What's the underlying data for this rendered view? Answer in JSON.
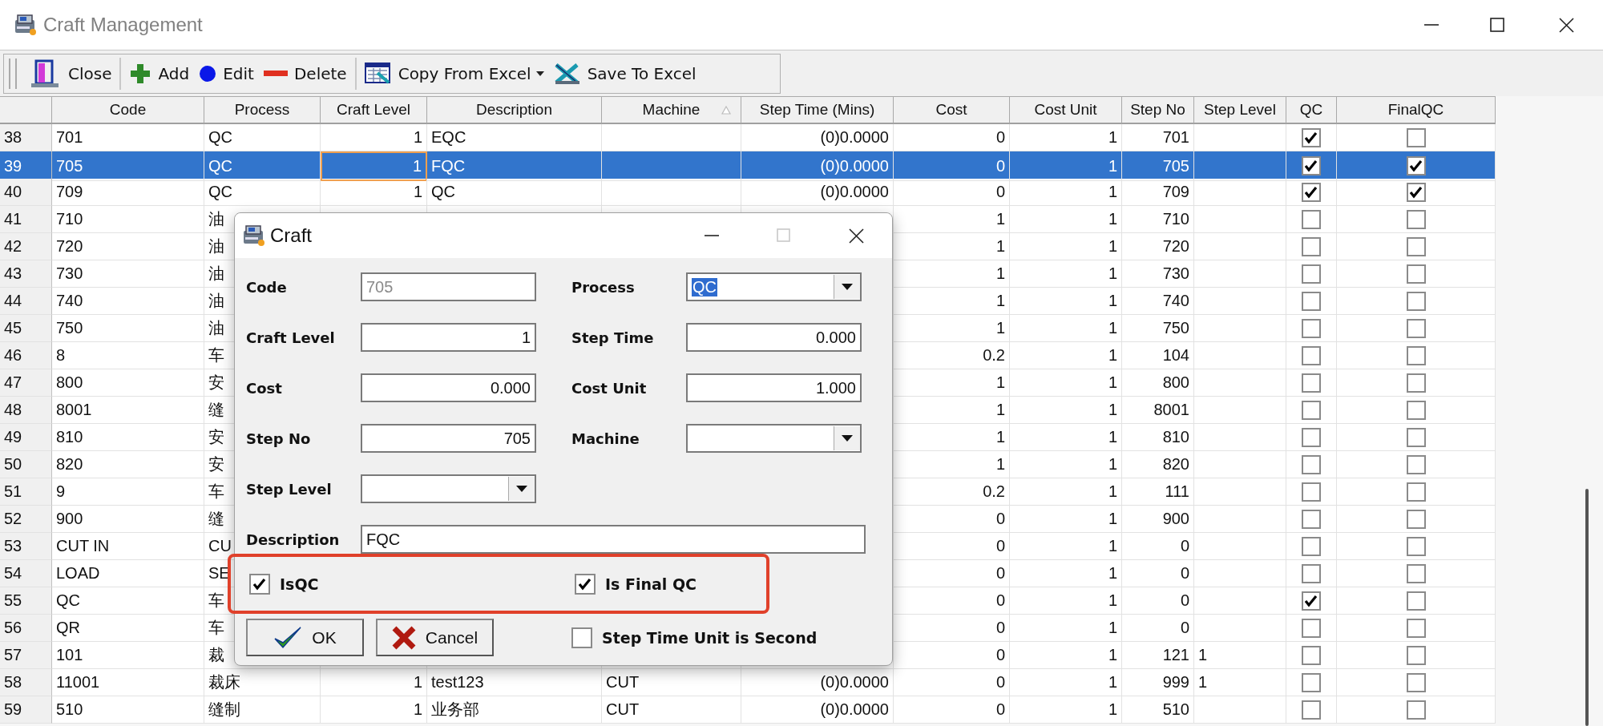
{
  "window": {
    "title": "Craft Management"
  },
  "toolbar": {
    "groups": [
      {
        "buttons": [
          {
            "label": "Close",
            "kind": "close"
          }
        ]
      },
      {
        "buttons": [
          {
            "label": "Add",
            "kind": "add"
          },
          {
            "label": "Edit",
            "kind": "edit"
          },
          {
            "label": "Delete",
            "kind": "delete"
          }
        ]
      },
      {
        "buttons": [
          {
            "label": "Copy From Excel",
            "kind": "copy",
            "dropdown": true
          },
          {
            "label": "Save To Excel",
            "kind": "save"
          }
        ]
      }
    ]
  },
  "table": {
    "columns": [
      {
        "label": "Code"
      },
      {
        "label": "Process"
      },
      {
        "label": "Craft Level"
      },
      {
        "label": "Description"
      },
      {
        "label": "Machine",
        "sorted": true
      },
      {
        "label": "Step Time (Mins)"
      },
      {
        "label": "Cost"
      },
      {
        "label": "Cost Unit"
      },
      {
        "label": "Step No"
      },
      {
        "label": "Step Level"
      },
      {
        "label": "QC"
      },
      {
        "label": "FinalQC"
      }
    ],
    "rows": [
      {
        "number": "38",
        "cells": [
          "701",
          "QC",
          "1",
          "EQC",
          null,
          "(0)0.0000",
          "0",
          "1",
          "701",
          null
        ],
        "qc": true,
        "final_qc": false,
        "selected": false
      },
      {
        "number": "39",
        "cells": [
          "705",
          "QC",
          {
            "text": "1",
            "focused": true
          },
          "FQC",
          null,
          "(0)0.0000",
          "0",
          "1",
          "705",
          null
        ],
        "qc": true,
        "final_qc": true,
        "selected": true
      },
      {
        "number": "40",
        "cells": [
          "709",
          "QC",
          "1",
          "QC",
          null,
          "(0)0.0000",
          "0",
          "1",
          "709",
          null
        ],
        "qc": true,
        "final_qc": true,
        "selected": false
      },
      {
        "number": "41",
        "cells": [
          "710",
          "油",
          null,
          null,
          null,
          null,
          "1",
          "1",
          "710",
          null
        ],
        "qc": false,
        "final_qc": false,
        "selected": false
      },
      {
        "number": "42",
        "cells": [
          "720",
          "油",
          null,
          null,
          null,
          null,
          "1",
          "1",
          "720",
          null
        ],
        "qc": false,
        "final_qc": false,
        "selected": false
      },
      {
        "number": "43",
        "cells": [
          "730",
          "油",
          null,
          null,
          null,
          null,
          "1",
          "1",
          "730",
          null
        ],
        "qc": false,
        "final_qc": false,
        "selected": false
      },
      {
        "number": "44",
        "cells": [
          "740",
          "油",
          null,
          null,
          null,
          null,
          "1",
          "1",
          "740",
          null
        ],
        "qc": false,
        "final_qc": false,
        "selected": false
      },
      {
        "number": "45",
        "cells": [
          "750",
          "油",
          null,
          null,
          null,
          null,
          "1",
          "1",
          "750",
          null
        ],
        "qc": false,
        "final_qc": false,
        "selected": false
      },
      {
        "number": "46",
        "cells": [
          "8",
          "车",
          null,
          null,
          null,
          null,
          "0.2",
          "1",
          "104",
          null
        ],
        "qc": false,
        "final_qc": false,
        "selected": false
      },
      {
        "number": "47",
        "cells": [
          "800",
          "安",
          null,
          null,
          null,
          null,
          "1",
          "1",
          "800",
          null
        ],
        "qc": false,
        "final_qc": false,
        "selected": false
      },
      {
        "number": "48",
        "cells": [
          "8001",
          "缝",
          null,
          null,
          null,
          null,
          "1",
          "1",
          "8001",
          null
        ],
        "qc": false,
        "final_qc": false,
        "selected": false
      },
      {
        "number": "49",
        "cells": [
          "810",
          "安",
          null,
          null,
          null,
          null,
          "1",
          "1",
          "810",
          null
        ],
        "qc": false,
        "final_qc": false,
        "selected": false
      },
      {
        "number": "50",
        "cells": [
          "820",
          "安",
          null,
          null,
          null,
          null,
          "1",
          "1",
          "820",
          null
        ],
        "qc": false,
        "final_qc": false,
        "selected": false
      },
      {
        "number": "51",
        "cells": [
          "9",
          "车",
          null,
          null,
          null,
          null,
          "0.2",
          "1",
          "111",
          null
        ],
        "qc": false,
        "final_qc": false,
        "selected": false
      },
      {
        "number": "52",
        "cells": [
          "900",
          "缝",
          null,
          null,
          null,
          null,
          "0",
          "1",
          "900",
          null
        ],
        "qc": false,
        "final_qc": false,
        "selected": false
      },
      {
        "number": "53",
        "cells": [
          "CUT IN",
          "CU",
          null,
          null,
          null,
          null,
          "0",
          "1",
          "0",
          null
        ],
        "qc": false,
        "final_qc": false,
        "selected": false
      },
      {
        "number": "54",
        "cells": [
          "LOAD",
          "SE",
          null,
          null,
          null,
          null,
          "0",
          "1",
          "0",
          null
        ],
        "qc": false,
        "final_qc": false,
        "selected": false
      },
      {
        "number": "55",
        "cells": [
          "QC",
          "车",
          null,
          null,
          null,
          null,
          "0",
          "1",
          "0",
          null
        ],
        "qc": true,
        "final_qc": false,
        "selected": false
      },
      {
        "number": "56",
        "cells": [
          "QR",
          "车",
          null,
          null,
          null,
          null,
          "0",
          "1",
          "0",
          null
        ],
        "qc": false,
        "final_qc": false,
        "selected": false
      },
      {
        "number": "57",
        "cells": [
          "101",
          "裁",
          null,
          null,
          null,
          null,
          "0",
          "1",
          "121",
          "1"
        ],
        "qc": false,
        "final_qc": false,
        "selected": false
      },
      {
        "number": "58",
        "cells": [
          "11001",
          "裁床",
          "1",
          "test123",
          "CUT",
          "(0)0.0000",
          "0",
          "1",
          "999",
          "1"
        ],
        "qc": false,
        "final_qc": false,
        "selected": false
      },
      {
        "number": "59",
        "cells": [
          "510",
          "缝制",
          "1",
          "业务部",
          "CUT",
          "(0)0.0000",
          "0",
          "1",
          "510",
          null
        ],
        "qc": false,
        "final_qc": false,
        "selected": false
      }
    ]
  },
  "dialog": {
    "title": "Craft",
    "fields": [
      {
        "label": "Code",
        "value": "705",
        "kind": "text",
        "disabled": true
      },
      {
        "label": "Process",
        "value": "QC",
        "kind": "combo",
        "text_selected": true
      },
      {
        "label": "Craft Level",
        "value": "1",
        "kind": "number",
        "disabled": false
      },
      {
        "label": "Step Time",
        "value": "0.000",
        "kind": "number",
        "disabled": false
      },
      {
        "label": "Cost",
        "value": "0.000",
        "kind": "number",
        "disabled": false
      },
      {
        "label": "Cost Unit",
        "value": "1.000",
        "kind": "number",
        "disabled": false
      },
      {
        "label": "Step No",
        "value": "705",
        "kind": "number",
        "disabled": false
      },
      {
        "label": "Machine",
        "kind": "combo"
      },
      {
        "label": "Step Level",
        "kind": "combo"
      },
      {
        "label": "Description",
        "value": "FQC",
        "kind": "long_text",
        "disabled": false
      }
    ],
    "highlight_frame": true,
    "checkboxes": [
      {
        "label": "IsQC",
        "checked": true
      },
      {
        "label": "Is Final QC",
        "checked": true
      },
      {
        "label": "Step Time Unit is Second",
        "checked": false
      }
    ],
    "buttons": [
      {
        "label": "OK",
        "kind": "ok"
      },
      {
        "label": "Cancel",
        "kind": "cancel"
      }
    ]
  }
}
